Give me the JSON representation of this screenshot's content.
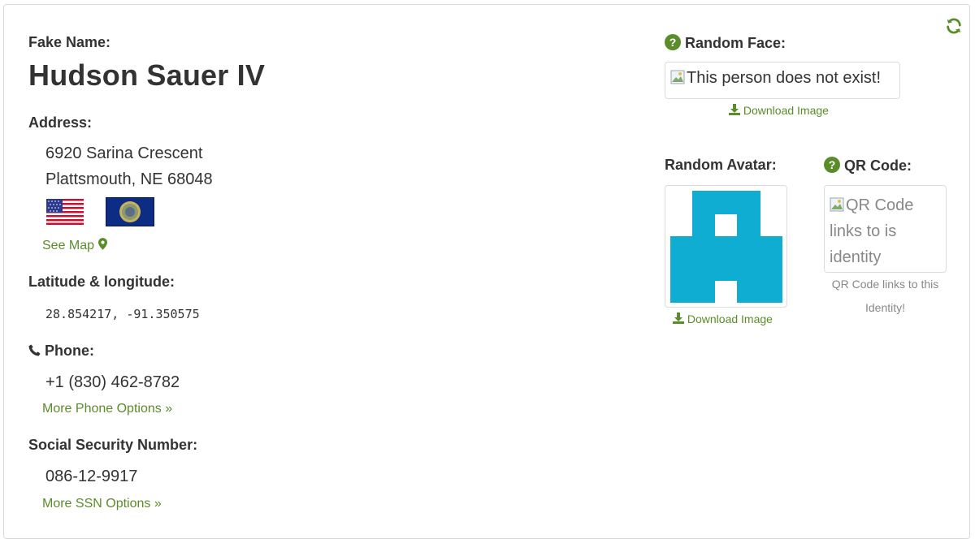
{
  "identity": {
    "fake_name_label": "Fake Name:",
    "name": "Hudson Sauer IV"
  },
  "address": {
    "label": "Address:",
    "line1": "6920 Sarina Crescent",
    "line2": "Plattsmouth, NE 68048",
    "see_map": "See Map"
  },
  "latlong": {
    "label": "Latitude & longitude:",
    "value": "28.854217, -91.350575"
  },
  "phone": {
    "label": "Phone:",
    "value": "+1 (830) 462-8782",
    "more": "More Phone Options »"
  },
  "ssn": {
    "label": "Social Security Number:",
    "value": "086-12-9917",
    "more": "More SSN Options »"
  },
  "face": {
    "label": "Random Face:",
    "alt": "This person does not exist!",
    "download": "Download Image"
  },
  "avatar": {
    "label": "Random Avatar:",
    "download": "Download Image"
  },
  "qr": {
    "label": "QR Code:",
    "alt": "QR Code links to is identity",
    "caption": "QR Code links to this Identity!"
  },
  "colors": {
    "accent": "#5b8c2a",
    "avatar": "#0fadd1",
    "text": "#333333"
  },
  "icons": {
    "refresh": "refresh-icon",
    "help": "question-circle-icon",
    "download": "download-icon",
    "map": "map-marker-icon",
    "phone": "phone-icon"
  }
}
